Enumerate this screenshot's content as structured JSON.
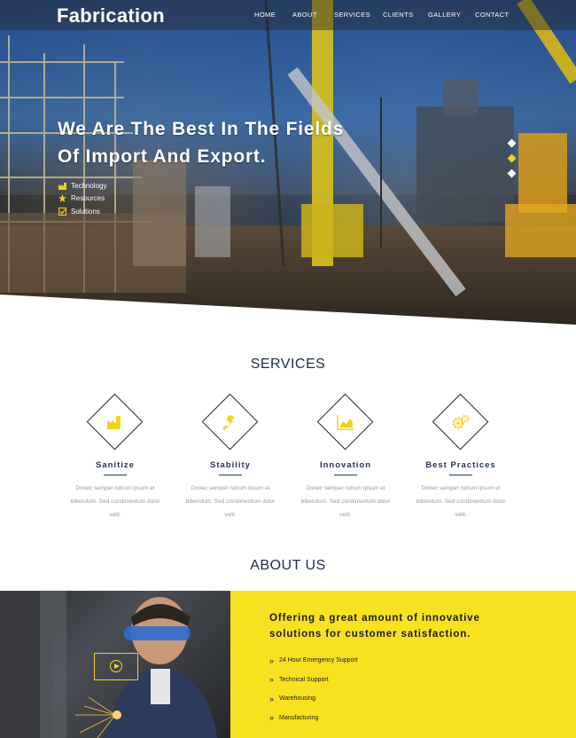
{
  "site": {
    "logo": "Fabrication"
  },
  "nav": {
    "items": [
      {
        "label": "HOME"
      },
      {
        "label": "ABOUT"
      },
      {
        "label": "SERVICES"
      },
      {
        "label": "CLIENTS"
      },
      {
        "label": "GALLERY"
      },
      {
        "label": "CONTACT"
      }
    ]
  },
  "hero": {
    "headline_line1": "We Are The Best In The Fields",
    "headline_line2": "Of Import And Export.",
    "features": [
      {
        "label": "Technology",
        "icon": "factory-icon"
      },
      {
        "label": "Resources",
        "icon": "star-icon"
      },
      {
        "label": "Solutions",
        "icon": "check-square-icon"
      }
    ],
    "slide_dots": {
      "count": 3,
      "active_index": 1
    },
    "accent_color": "#f0d31e"
  },
  "services": {
    "title": "SERVICES",
    "items": [
      {
        "title": "Sanitize",
        "icon": "factory-icon",
        "text_line1": "Donec semper rutrum ipsum et",
        "text_line2": "bibendum. Sed condimentum dolor",
        "text_line3": "velit."
      },
      {
        "title": "Stability",
        "icon": "wrench-icon",
        "text_line1": "Donec semper rutrum ipsum et",
        "text_line2": "bibendum. Sed condimentum dolor",
        "text_line3": "velit."
      },
      {
        "title": "Innovation",
        "icon": "area-chart-icon",
        "text_line1": "Donec semper rutrum ipsum et",
        "text_line2": "bibendum. Sed condimentum dolor",
        "text_line3": "velit."
      },
      {
        "title": "Best Practices",
        "icon": "gears-icon",
        "text_line1": "Donec semper rutrum ipsum et",
        "text_line2": "bibendum. Sed condimentum dolor",
        "text_line3": "velit."
      }
    ]
  },
  "about": {
    "title": "ABOUT US",
    "heading_line1": "Offering a great amount of innovative",
    "heading_line2": "solutions for customer satisfaction.",
    "list": [
      {
        "label": "24 Hour Emergency Support"
      },
      {
        "label": "Technical Support"
      },
      {
        "label": "Warehousing"
      },
      {
        "label": "Manufacturing"
      }
    ],
    "panel_color": "#f8e220"
  }
}
